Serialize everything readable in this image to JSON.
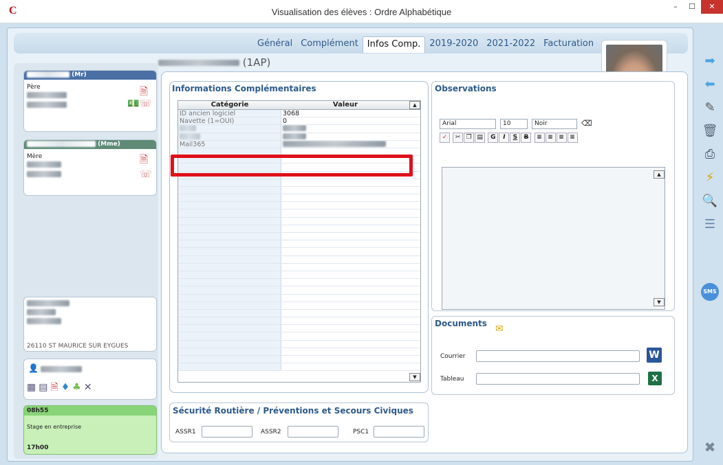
{
  "window": {
    "title": "Visualisation des élèves : Ordre Alphabétique",
    "logo": "C",
    "minimize": "–",
    "maximize": "☐",
    "close": "✕"
  },
  "tabs": [
    {
      "label": "Général"
    },
    {
      "label": "Complément"
    },
    {
      "label": "Infos Comp."
    },
    {
      "label": "2019-2020"
    },
    {
      "label": "2021-2022"
    },
    {
      "label": "Facturation"
    }
  ],
  "student": {
    "class": "(1AP)"
  },
  "father": {
    "title": "(Mr)",
    "role": "Père"
  },
  "mother": {
    "title": "(Mme)",
    "role": "Mère"
  },
  "address": {
    "city": "26110 ST MAURICE SUR EYGUES"
  },
  "schedule": {
    "start": "08h55",
    "label": "Stage en entreprise",
    "end": "17h00"
  },
  "info": {
    "title": "Informations Complémentaires",
    "col_category": "Catégorie",
    "col_value": "Valeur",
    "rows": [
      {
        "category": "ID ancien logiciel",
        "value": "3068"
      },
      {
        "category": "Navette (1=OUI)",
        "value": "0"
      },
      {
        "category": "",
        "value": ""
      },
      {
        "category": "",
        "value": ""
      },
      {
        "category": "Mail365",
        "value": ""
      }
    ]
  },
  "observations": {
    "title": "Observations",
    "font": "Arial",
    "size": "10",
    "color": "Noir"
  },
  "documents": {
    "title": "Documents",
    "courrier_label": "Courrier",
    "tableau_label": "Tableau"
  },
  "securite": {
    "title": "Sécurité Routière / Préventions et Secours Civiques",
    "assr1": "ASSR1",
    "assr2": "ASSR2",
    "psc1": "PSC1"
  },
  "sms": "SMS",
  "colors": {
    "accent": "#2d5a8a",
    "highlight": "#e0101a",
    "father_header": "#4a6fa5",
    "mother_header": "#5e8a76",
    "schedule_bg": "#c8f0b8"
  }
}
